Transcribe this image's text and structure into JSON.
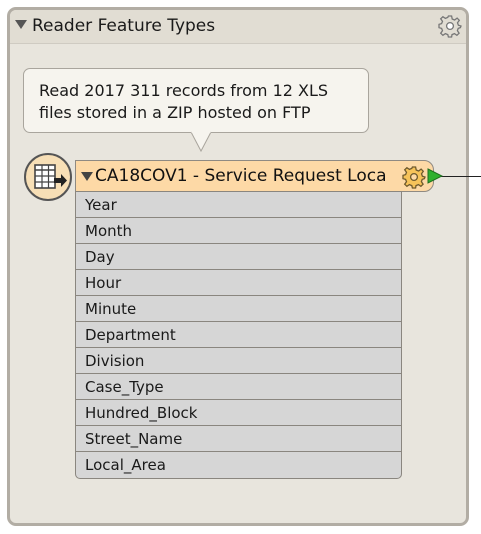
{
  "bookmark": {
    "title": "Reader Feature Types",
    "gear_icon": "gear-icon",
    "collapse_icon": "triangle-down-icon"
  },
  "annotation": {
    "text_line1": "Read 2017 311 records from 12 XLS",
    "text_line2": "files stored in a ZIP hosted on FTP"
  },
  "feature_type": {
    "name": "CA18COV1 - Service Request Loca",
    "reader_icon": "table-reader-icon",
    "gear_icon": "gear-icon",
    "output_port_icon": "output-port-icon",
    "header_color": "#fdd9a6",
    "port_color": "#2fb02f"
  },
  "attributes": [
    "Year",
    "Month",
    "Day",
    "Hour",
    "Minute",
    "Department",
    "Division",
    "Case_Type",
    "Hundred_Block",
    "Street_Name",
    "Local_Area"
  ]
}
